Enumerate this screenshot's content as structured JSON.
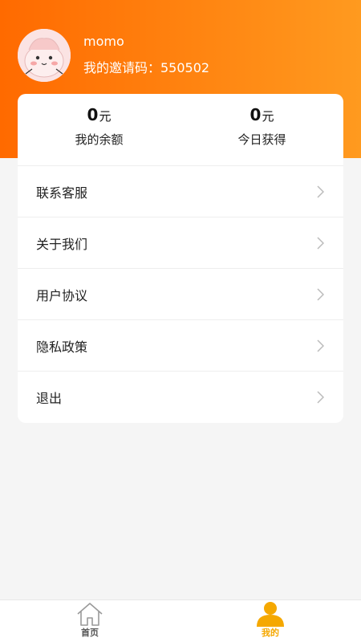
{
  "profile": {
    "username": "momo",
    "invite_text": "我的邀请码：550502"
  },
  "stats": {
    "balance": {
      "value": "0",
      "unit": "元",
      "label": "我的余额"
    },
    "today": {
      "value": "0",
      "unit": "元",
      "label": "今日获得"
    }
  },
  "menu": {
    "items": [
      {
        "label": "联系客服"
      },
      {
        "label": "关于我们"
      },
      {
        "label": "用户协议"
      },
      {
        "label": "隐私政策"
      },
      {
        "label": "退出"
      }
    ]
  },
  "tabbar": {
    "home": {
      "label": "首页",
      "icon": "home-icon"
    },
    "mine": {
      "label": "我的",
      "icon": "user-icon"
    }
  },
  "colors": {
    "header_start": "#ff6a00",
    "header_end": "#ff9a1f",
    "active_tab": "#f5a800"
  }
}
